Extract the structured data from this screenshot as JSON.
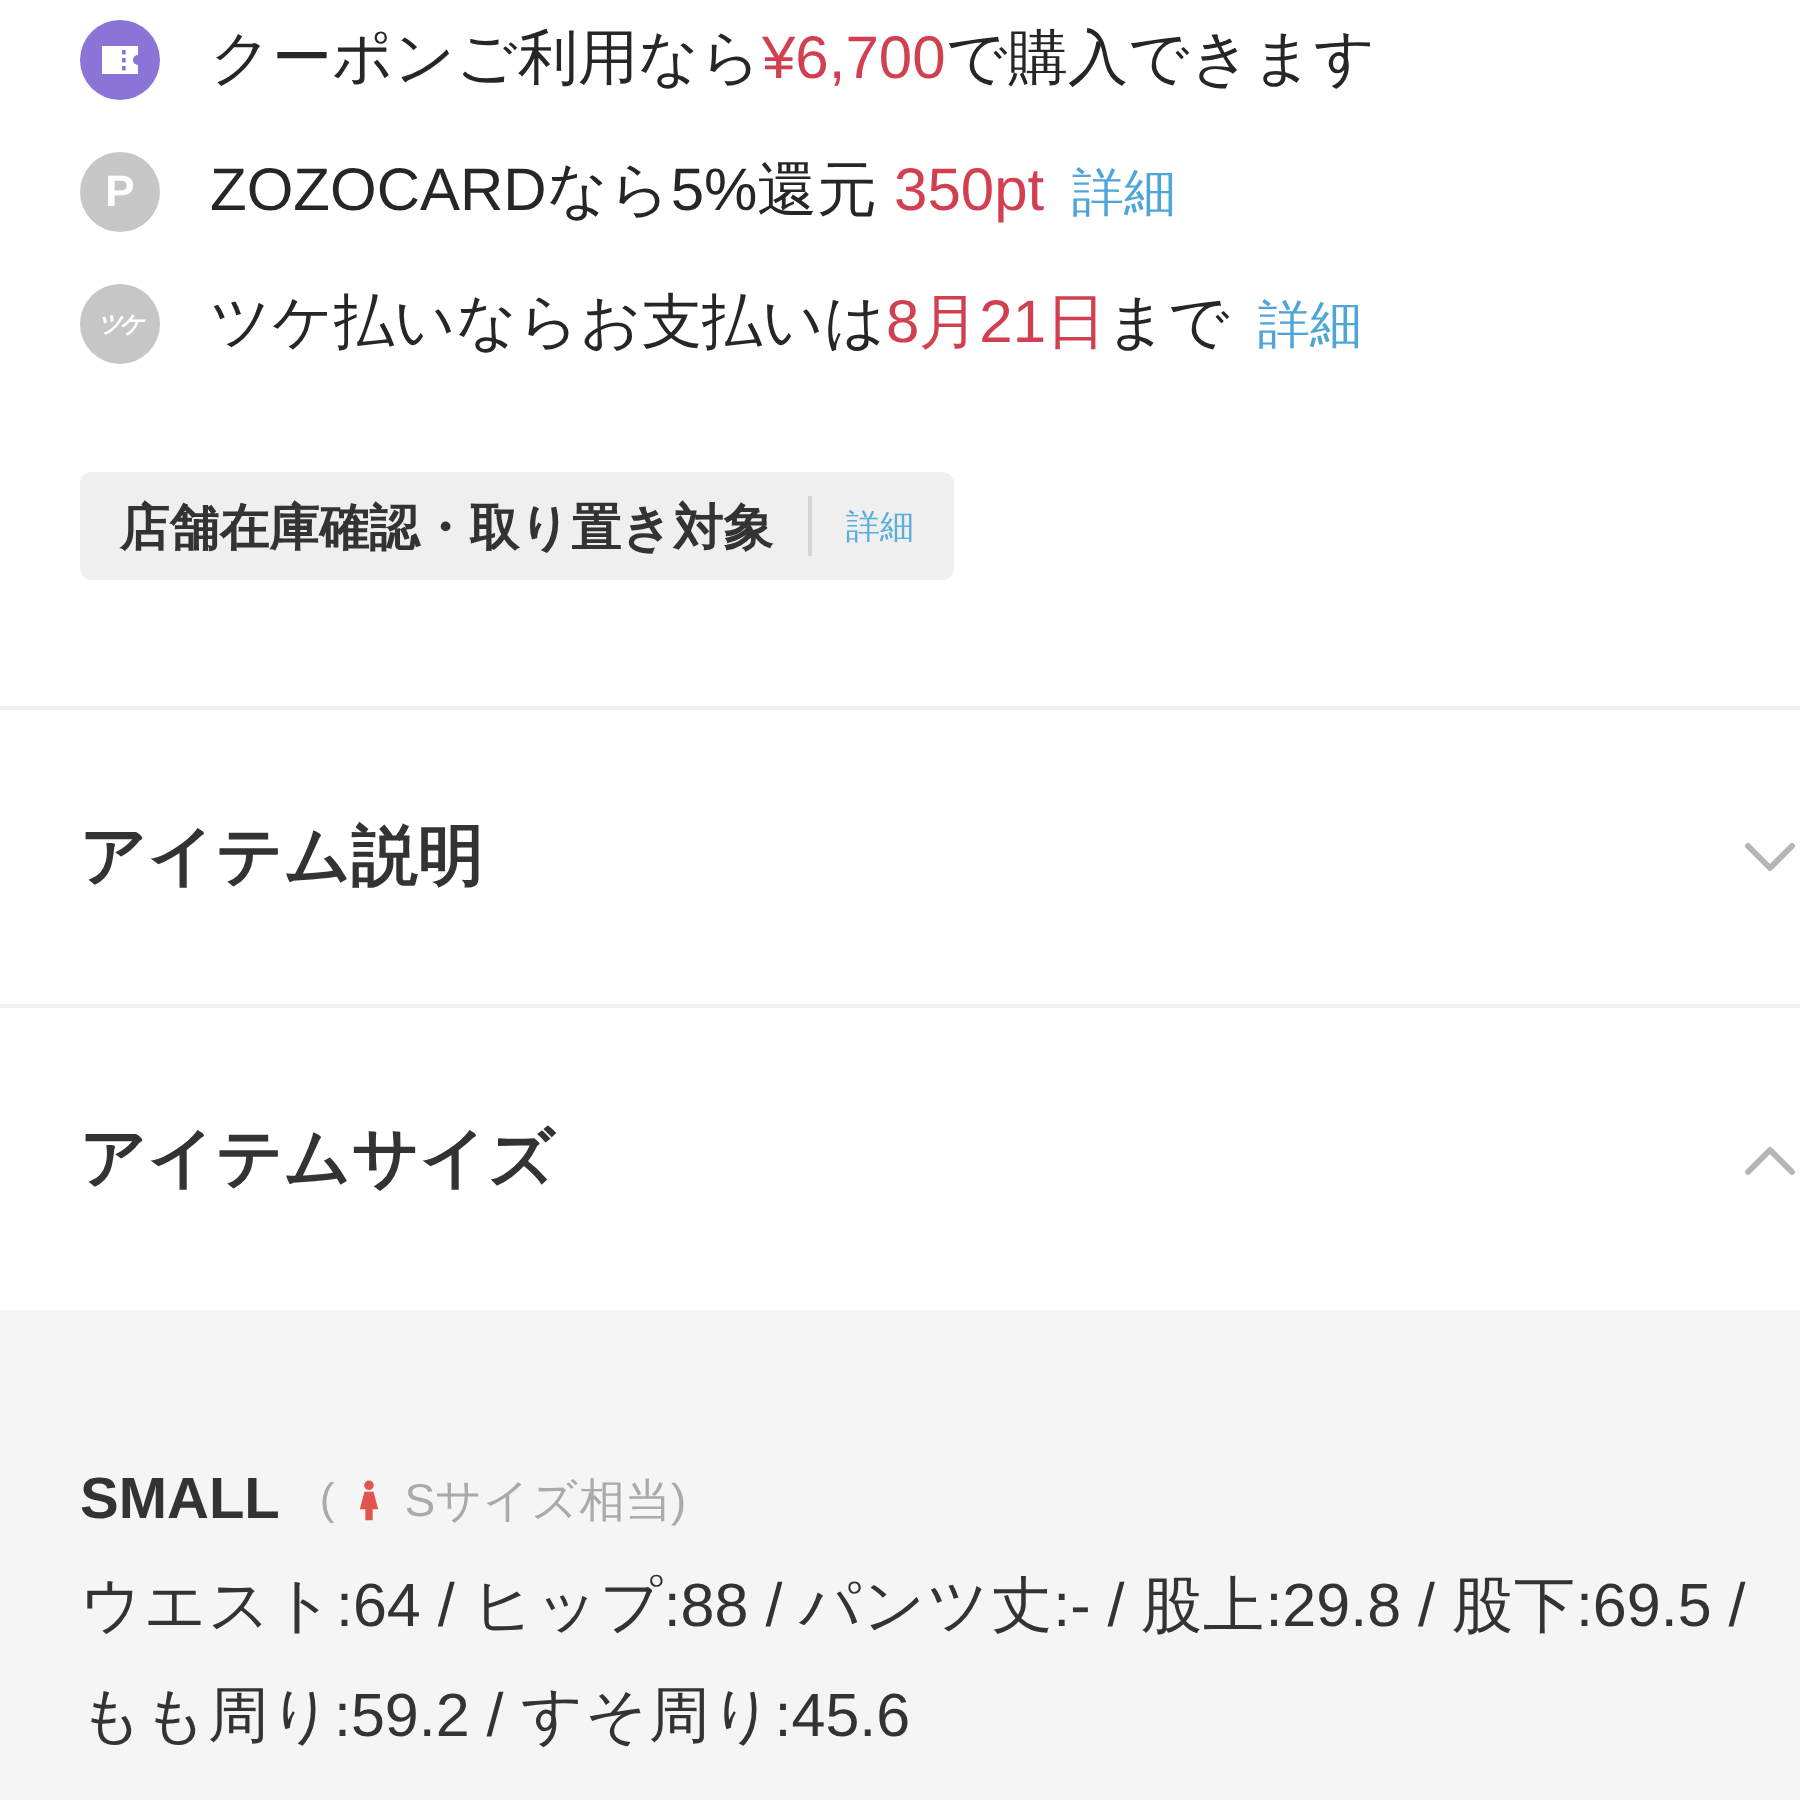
{
  "benefits": [
    {
      "kind": "coupon",
      "segments": [
        {
          "text": "クーポンご利用なら",
          "highlight": false
        },
        {
          "text": "¥6,700",
          "highlight": true
        },
        {
          "text": "で購入できます",
          "highlight": false
        }
      ]
    },
    {
      "kind": "points",
      "icon_text": "P",
      "segments": [
        {
          "text": "ZOZOCARDなら5%還元 ",
          "highlight": false
        },
        {
          "text": "350pt",
          "highlight": true
        }
      ],
      "link": "詳細"
    },
    {
      "kind": "tsuke",
      "icon_text": "ツケ",
      "segments": [
        {
          "text": "ツケ払いならお支払いは",
          "highlight": false
        },
        {
          "text": "8月21日",
          "highlight": true
        },
        {
          "text": "まで",
          "highlight": false
        }
      ],
      "link": "詳細"
    }
  ],
  "store_badge": {
    "label": "店舗在庫確認・取り置き対象",
    "link": "詳細"
  },
  "sections": [
    {
      "title": "アイテム説明",
      "expanded": false
    },
    {
      "title": "アイテムサイズ",
      "expanded": true
    }
  ],
  "size_panel": {
    "name": "SMALL",
    "paren_open": "(",
    "equivalent": "Sサイズ相当)",
    "lines": [
      "ウエスト:64 / ヒップ:88 / パンツ丈:- / 股上:29.8 / 股下:69.5 /",
      "もも周り:59.2 / すそ周り:45.6"
    ]
  }
}
